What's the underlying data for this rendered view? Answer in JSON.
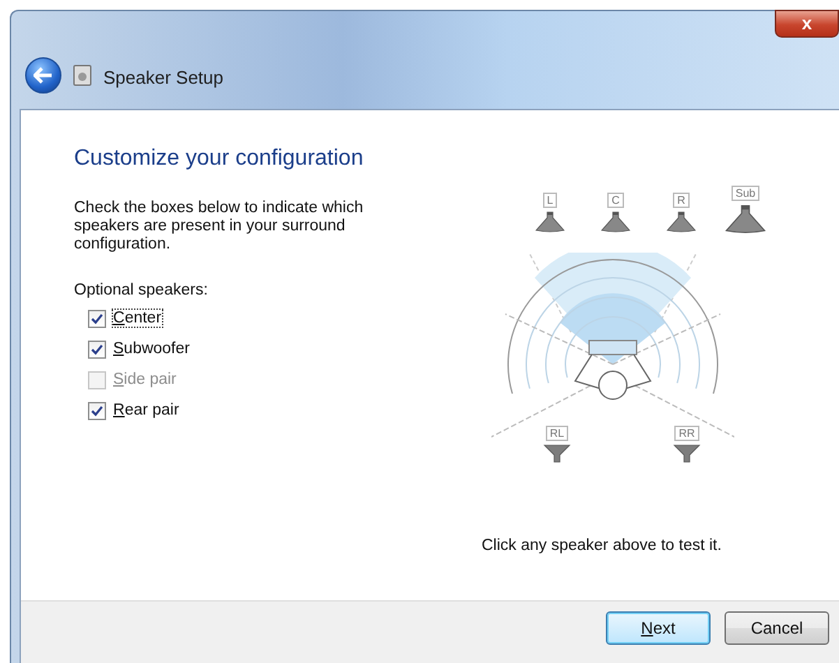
{
  "window": {
    "title": "Speaker Setup",
    "close_label": "x"
  },
  "heading": "Customize your configuration",
  "instructions": "Check the boxes below to indicate which speakers are present in your surround configuration.",
  "group_label": "Optional speakers:",
  "speakers": [
    {
      "label": "Center",
      "checked": true,
      "disabled": false,
      "focused": true
    },
    {
      "label": "Subwoofer",
      "checked": true,
      "disabled": false,
      "focused": false
    },
    {
      "label": "Side pair",
      "checked": false,
      "disabled": true,
      "focused": false
    },
    {
      "label": "Rear pair",
      "checked": true,
      "disabled": false,
      "focused": false
    }
  ],
  "diagram": {
    "speakers": [
      {
        "label": "L",
        "kind": "frontleft"
      },
      {
        "label": "C",
        "kind": "center"
      },
      {
        "label": "R",
        "kind": "frontright"
      },
      {
        "label": "Sub",
        "kind": "sub"
      },
      {
        "label": "RL",
        "kind": "rearleft"
      },
      {
        "label": "RR",
        "kind": "rearright"
      }
    ]
  },
  "hint": "Click any speaker above to test it.",
  "buttons": [
    {
      "label": "Next",
      "default": true
    },
    {
      "label": "Cancel",
      "default": false
    }
  ]
}
